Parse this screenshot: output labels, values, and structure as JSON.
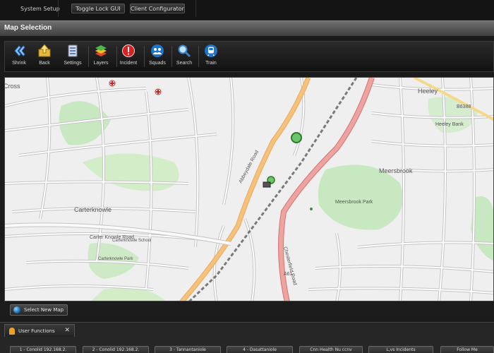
{
  "top_bar": {
    "system_setup": "System Setup",
    "toggle_lock": "Toggle Lock GUI",
    "client_configurator": "Client Configurator"
  },
  "header": {
    "title": "Map Selection"
  },
  "toolbar": {
    "items": [
      {
        "label": "Shrink",
        "icon": "chevron-left-icon"
      },
      {
        "label": "Back",
        "icon": "folder-up-icon"
      },
      {
        "label": "Settings",
        "icon": "settings-icon"
      },
      {
        "label": "Layers",
        "icon": "layers-icon"
      },
      {
        "label": "Incident",
        "icon": "alert-icon"
      },
      {
        "label": "Squads",
        "icon": "squads-icon"
      },
      {
        "label": "Search",
        "icon": "search-icon"
      },
      {
        "label": "Train",
        "icon": "train-icon"
      }
    ]
  },
  "map": {
    "labels": {
      "carterknowle": "Carterknowle",
      "meersbrook": "Meersbrook",
      "meersbrook_park": "Meersbrook Park",
      "heeley": "Heeley",
      "heeley_bank": "Heeley Bank",
      "carter_knowle_road": "Carter Knowle Road",
      "abbeydale_road": "Abbeydale Road",
      "chesterfield_road": "Chesterfield Road",
      "b6388": "B6388",
      "a61": "A61",
      "cross": "Cross",
      "school": "Carterknowle School",
      "knowle_park": "Carterknowle Park"
    }
  },
  "bottom": {
    "select_new_map": "Select New Map",
    "user_functions_tab": "User Functions",
    "tab_close": "✕",
    "function_buttons": [
      "1 - Conolid 192.168.2.",
      "2 - Conolid 192.168.2.",
      "3 - Tannantaniole",
      "4 - Dasattaniole",
      "Cnn Health Nu ccnv",
      "L,vs Incidents",
      "Follow Me"
    ]
  },
  "colors": {
    "chrome_dark": "#1b1b1b",
    "header_gradient": "#5a5a5a",
    "road_orange": "#f4b36b",
    "road_red": "#e58a88",
    "park_green": "#c7e8c1",
    "map_background": "#efefef"
  }
}
